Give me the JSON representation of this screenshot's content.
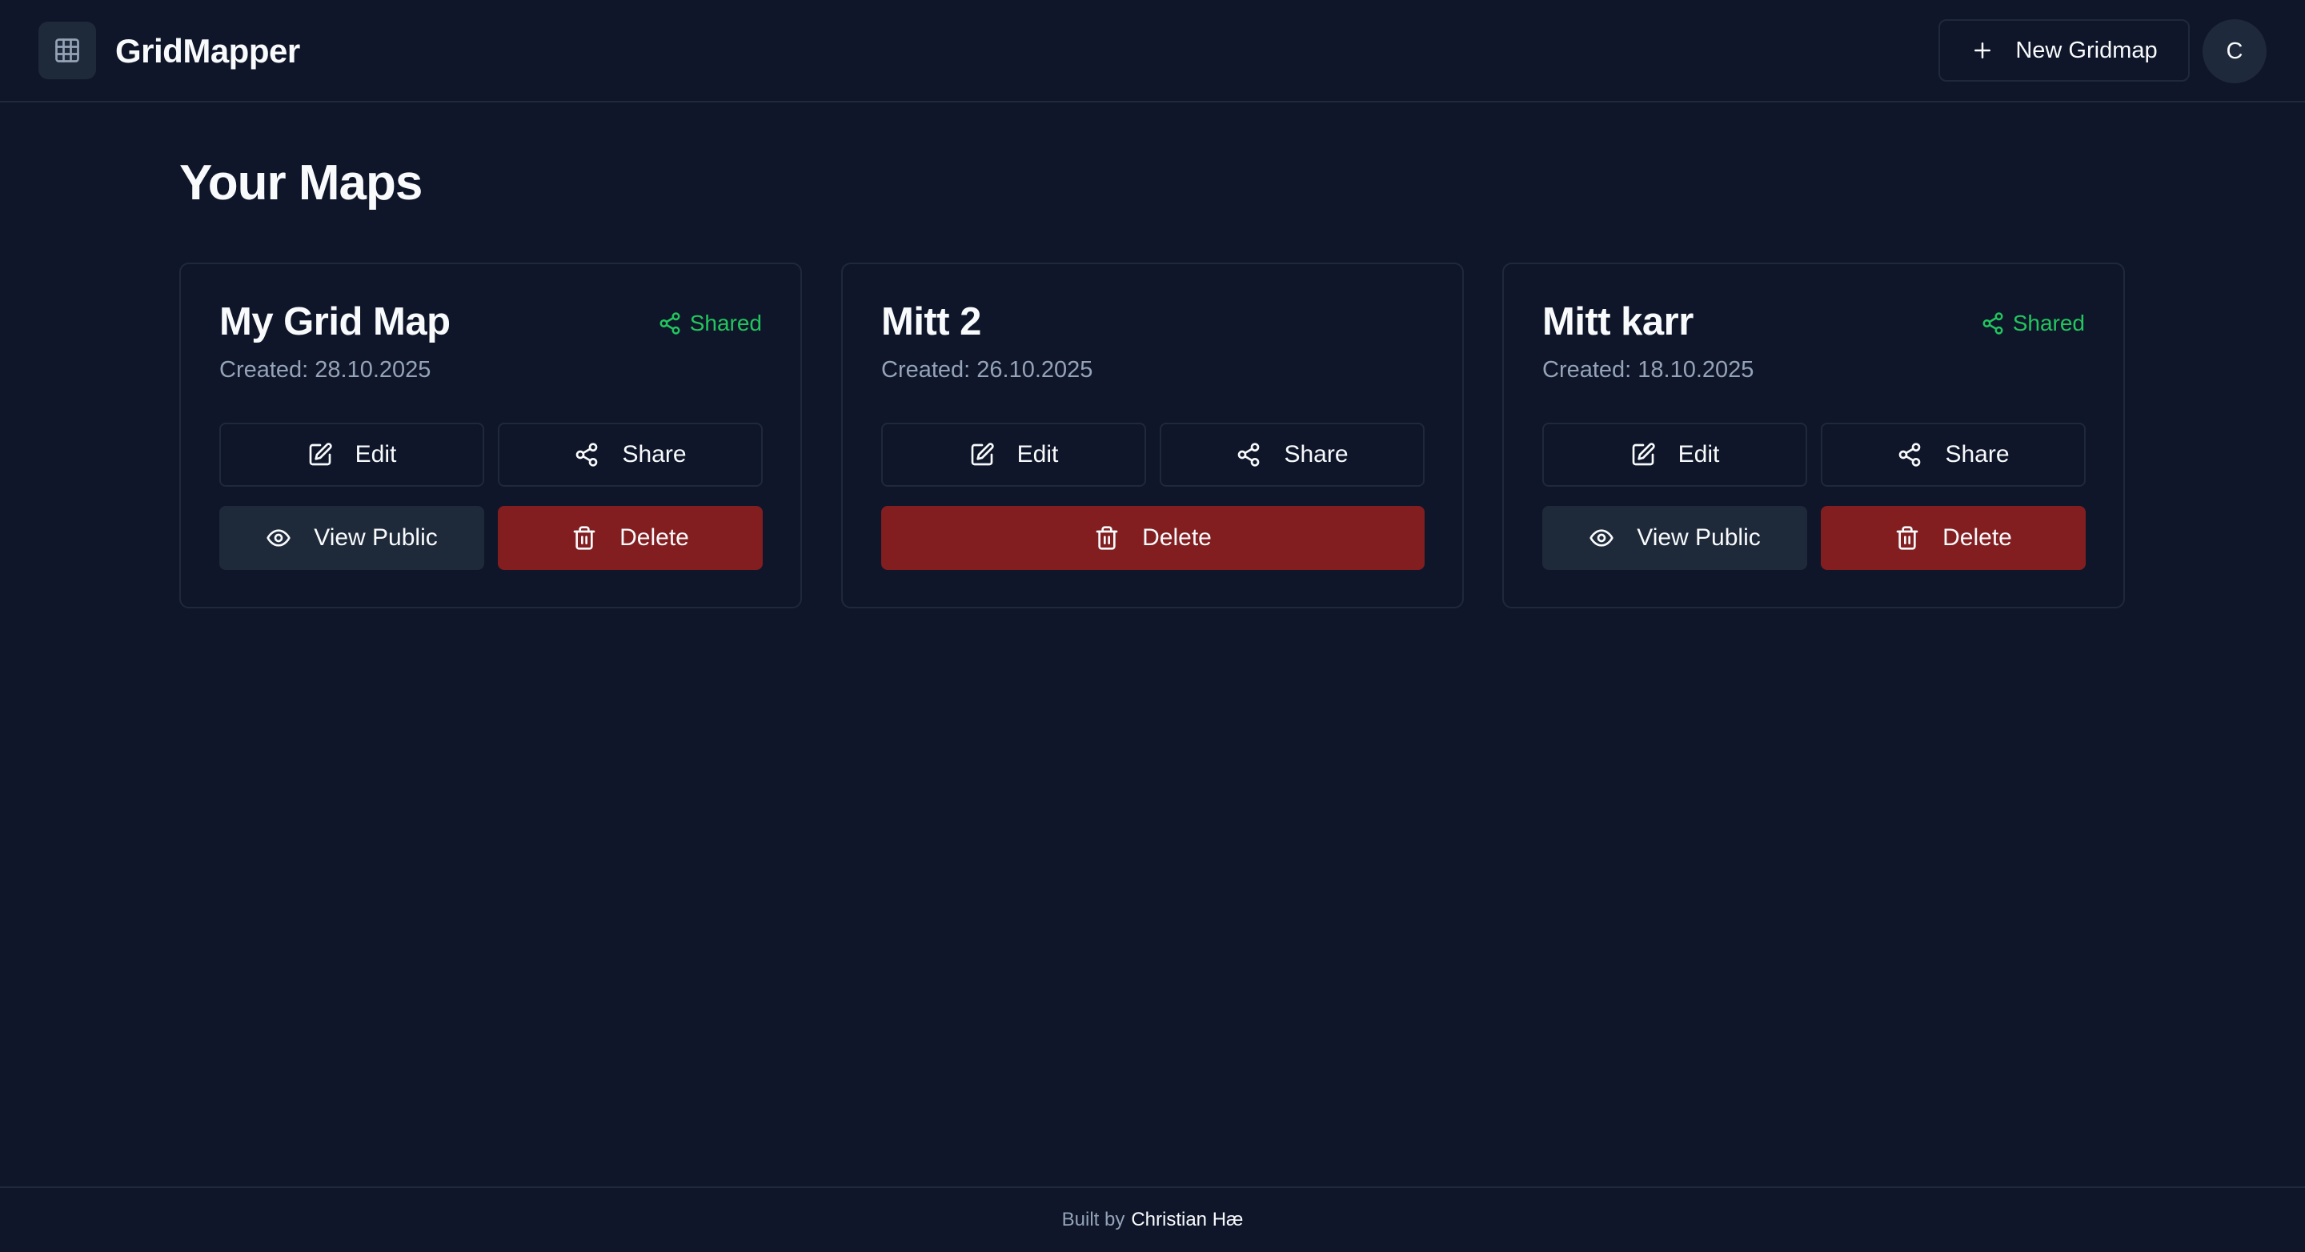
{
  "header": {
    "app_title": "GridMapper",
    "new_button_label": "New Gridmap",
    "avatar_initial": "C"
  },
  "main": {
    "title": "Your Maps",
    "cards": [
      {
        "title": "My Grid Map",
        "created": "Created: 28.10.2025",
        "shared_label": "Shared",
        "edit_label": "Edit",
        "share_label": "Share",
        "view_public_label": "View Public",
        "delete_label": "Delete"
      },
      {
        "title": "Mitt 2",
        "created": "Created: 26.10.2025",
        "edit_label": "Edit",
        "share_label": "Share",
        "delete_label": "Delete"
      },
      {
        "title": "Mitt karr",
        "created": "Created: 18.10.2025",
        "shared_label": "Shared",
        "edit_label": "Edit",
        "share_label": "Share",
        "view_public_label": "View Public",
        "delete_label": "Delete"
      }
    ]
  },
  "footer": {
    "prefix": "Built by",
    "author": "Christian Hæ"
  },
  "colors": {
    "background": "#0f1629",
    "accent_green": "#22c55e",
    "danger": "#821e20",
    "secondary": "#1e2939"
  },
  "icons": {
    "logo": "grid-icon",
    "new": "plus-icon",
    "shared": "share-icon",
    "edit": "edit-icon",
    "share": "share-icon",
    "view_public": "eye-icon",
    "delete": "trash-icon"
  }
}
